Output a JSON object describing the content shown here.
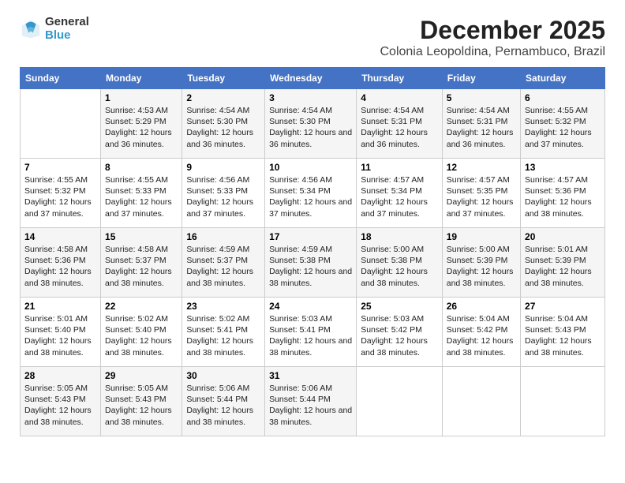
{
  "logo": {
    "line1": "General",
    "line2": "Blue"
  },
  "header": {
    "month": "December 2025",
    "location": "Colonia Leopoldina, Pernambuco, Brazil"
  },
  "weekdays": [
    "Sunday",
    "Monday",
    "Tuesday",
    "Wednesday",
    "Thursday",
    "Friday",
    "Saturday"
  ],
  "weeks": [
    [
      {
        "day": "",
        "sunrise": "",
        "sunset": "",
        "daylight": ""
      },
      {
        "day": "1",
        "sunrise": "4:53 AM",
        "sunset": "5:29 PM",
        "daylight": "12 hours and 36 minutes."
      },
      {
        "day": "2",
        "sunrise": "4:54 AM",
        "sunset": "5:30 PM",
        "daylight": "12 hours and 36 minutes."
      },
      {
        "day": "3",
        "sunrise": "4:54 AM",
        "sunset": "5:30 PM",
        "daylight": "12 hours and 36 minutes."
      },
      {
        "day": "4",
        "sunrise": "4:54 AM",
        "sunset": "5:31 PM",
        "daylight": "12 hours and 36 minutes."
      },
      {
        "day": "5",
        "sunrise": "4:54 AM",
        "sunset": "5:31 PM",
        "daylight": "12 hours and 36 minutes."
      },
      {
        "day": "6",
        "sunrise": "4:55 AM",
        "sunset": "5:32 PM",
        "daylight": "12 hours and 37 minutes."
      }
    ],
    [
      {
        "day": "7",
        "sunrise": "4:55 AM",
        "sunset": "5:32 PM",
        "daylight": "12 hours and 37 minutes."
      },
      {
        "day": "8",
        "sunrise": "4:55 AM",
        "sunset": "5:33 PM",
        "daylight": "12 hours and 37 minutes."
      },
      {
        "day": "9",
        "sunrise": "4:56 AM",
        "sunset": "5:33 PM",
        "daylight": "12 hours and 37 minutes."
      },
      {
        "day": "10",
        "sunrise": "4:56 AM",
        "sunset": "5:34 PM",
        "daylight": "12 hours and 37 minutes."
      },
      {
        "day": "11",
        "sunrise": "4:57 AM",
        "sunset": "5:34 PM",
        "daylight": "12 hours and 37 minutes."
      },
      {
        "day": "12",
        "sunrise": "4:57 AM",
        "sunset": "5:35 PM",
        "daylight": "12 hours and 37 minutes."
      },
      {
        "day": "13",
        "sunrise": "4:57 AM",
        "sunset": "5:36 PM",
        "daylight": "12 hours and 38 minutes."
      }
    ],
    [
      {
        "day": "14",
        "sunrise": "4:58 AM",
        "sunset": "5:36 PM",
        "daylight": "12 hours and 38 minutes."
      },
      {
        "day": "15",
        "sunrise": "4:58 AM",
        "sunset": "5:37 PM",
        "daylight": "12 hours and 38 minutes."
      },
      {
        "day": "16",
        "sunrise": "4:59 AM",
        "sunset": "5:37 PM",
        "daylight": "12 hours and 38 minutes."
      },
      {
        "day": "17",
        "sunrise": "4:59 AM",
        "sunset": "5:38 PM",
        "daylight": "12 hours and 38 minutes."
      },
      {
        "day": "18",
        "sunrise": "5:00 AM",
        "sunset": "5:38 PM",
        "daylight": "12 hours and 38 minutes."
      },
      {
        "day": "19",
        "sunrise": "5:00 AM",
        "sunset": "5:39 PM",
        "daylight": "12 hours and 38 minutes."
      },
      {
        "day": "20",
        "sunrise": "5:01 AM",
        "sunset": "5:39 PM",
        "daylight": "12 hours and 38 minutes."
      }
    ],
    [
      {
        "day": "21",
        "sunrise": "5:01 AM",
        "sunset": "5:40 PM",
        "daylight": "12 hours and 38 minutes."
      },
      {
        "day": "22",
        "sunrise": "5:02 AM",
        "sunset": "5:40 PM",
        "daylight": "12 hours and 38 minutes."
      },
      {
        "day": "23",
        "sunrise": "5:02 AM",
        "sunset": "5:41 PM",
        "daylight": "12 hours and 38 minutes."
      },
      {
        "day": "24",
        "sunrise": "5:03 AM",
        "sunset": "5:41 PM",
        "daylight": "12 hours and 38 minutes."
      },
      {
        "day": "25",
        "sunrise": "5:03 AM",
        "sunset": "5:42 PM",
        "daylight": "12 hours and 38 minutes."
      },
      {
        "day": "26",
        "sunrise": "5:04 AM",
        "sunset": "5:42 PM",
        "daylight": "12 hours and 38 minutes."
      },
      {
        "day": "27",
        "sunrise": "5:04 AM",
        "sunset": "5:43 PM",
        "daylight": "12 hours and 38 minutes."
      }
    ],
    [
      {
        "day": "28",
        "sunrise": "5:05 AM",
        "sunset": "5:43 PM",
        "daylight": "12 hours and 38 minutes."
      },
      {
        "day": "29",
        "sunrise": "5:05 AM",
        "sunset": "5:43 PM",
        "daylight": "12 hours and 38 minutes."
      },
      {
        "day": "30",
        "sunrise": "5:06 AM",
        "sunset": "5:44 PM",
        "daylight": "12 hours and 38 minutes."
      },
      {
        "day": "31",
        "sunrise": "5:06 AM",
        "sunset": "5:44 PM",
        "daylight": "12 hours and 38 minutes."
      },
      {
        "day": "",
        "sunrise": "",
        "sunset": "",
        "daylight": ""
      },
      {
        "day": "",
        "sunrise": "",
        "sunset": "",
        "daylight": ""
      },
      {
        "day": "",
        "sunrise": "",
        "sunset": "",
        "daylight": ""
      }
    ]
  ]
}
